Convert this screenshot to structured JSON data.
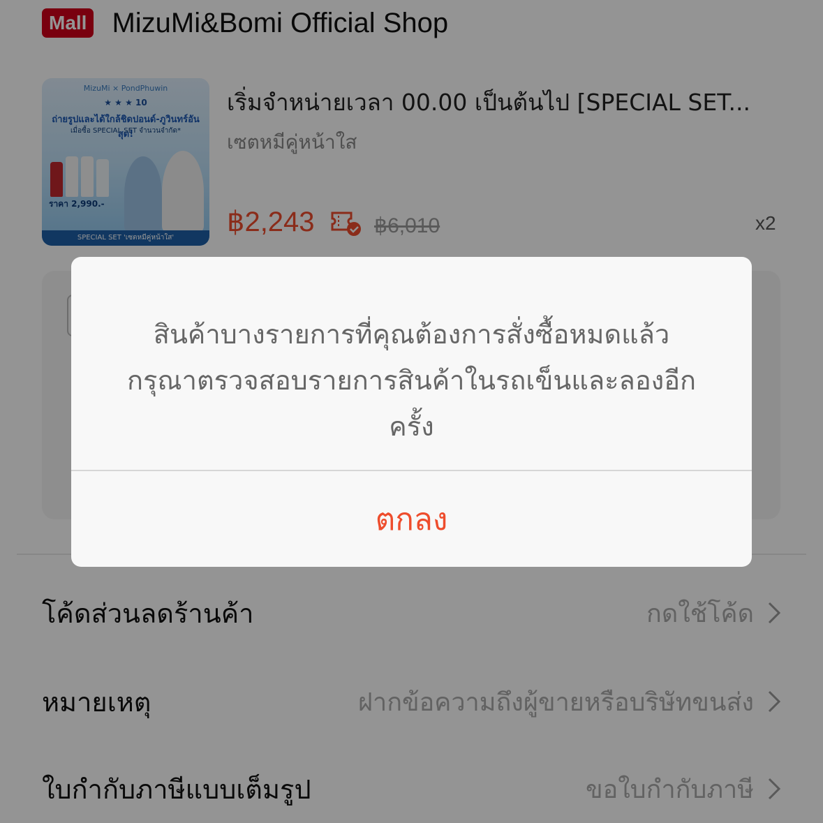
{
  "shop": {
    "badge": "Mall",
    "name": "MizuMi&Bomi Official Shop"
  },
  "product": {
    "thumbnail": {
      "brand": "MizuMi × PondPhuwin",
      "stars": "★ ★ ★  10",
      "headline": "ถ่ายรูปและได้ใกล้ชิดปอนด์-ภูวินทร์อันสุด!",
      "subline": "เมื่อซื้อ SPECIAL SET จำนวนจำกัด*",
      "price_label": "ราคา 2,990.-",
      "footer": "SPECIAL SET 'เซตหมีคู่หน้าใส'"
    },
    "title": "เริ่มจำหน่ายเวลา 00.00 เป็นต้นไป [SPECIAL SET...",
    "variant": "เซตหมีคู่หน้าใส",
    "price": "฿2,243",
    "original_price": "฿6,010",
    "quantity": "x2"
  },
  "rows": [
    {
      "label": "โค้ดส่วนลดร้านค้า",
      "value": "กดใช้โค้ด"
    },
    {
      "label": "หมายเหตุ",
      "value": "ฝากข้อความถึงผู้ขายหรือบริษัทขนส่ง"
    },
    {
      "label": "ใบกำกับภาษีแบบเต็มรูป",
      "value": "ขอใบกำกับภาษี"
    }
  ],
  "dialog": {
    "message_lines": [
      "สินค้าบางรายการที่คุณต้องการสั่งซื้อหมดแล้ว",
      "กรุณาตรวจสอบรายการสินค้าในรถเข็นและลองอีก",
      "ครั้ง"
    ],
    "ok_label": "ตกลง"
  },
  "colors": {
    "accent": "#ee4d2d",
    "mall": "#d0011b"
  }
}
